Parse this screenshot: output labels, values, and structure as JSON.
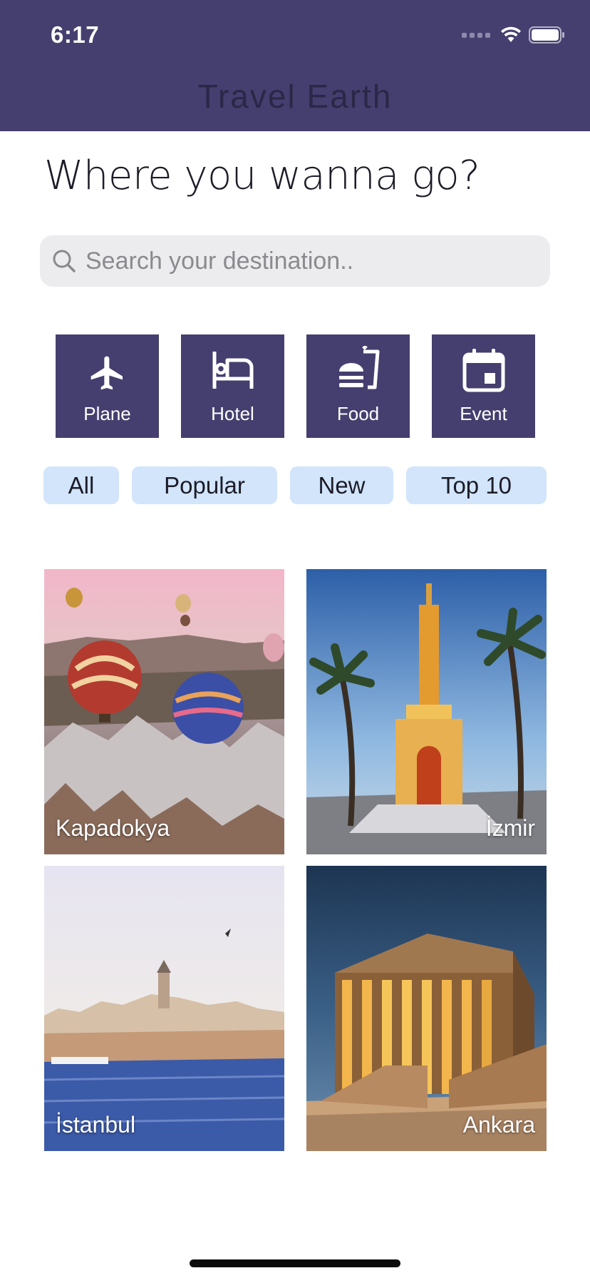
{
  "status_bar": {
    "time": "6:17"
  },
  "header": {
    "title": "Travel Earth"
  },
  "headline": "Where you wanna go?",
  "search": {
    "placeholder": "Search your destination.."
  },
  "categories": [
    {
      "label": "Plane",
      "icon": "plane-icon"
    },
    {
      "label": "Hotel",
      "icon": "bed-icon"
    },
    {
      "label": "Food",
      "icon": "food-icon"
    },
    {
      "label": "Event",
      "icon": "calendar-icon"
    }
  ],
  "filters": [
    "All",
    "Popular",
    "New",
    "Top 10"
  ],
  "destinations": [
    {
      "name": "Kapadokya"
    },
    {
      "name": "İzmir"
    },
    {
      "name": "İstanbul"
    },
    {
      "name": "Ankara"
    }
  ],
  "colors": {
    "primary": "#453f6f",
    "chip": "#d2e5fb",
    "search_bg": "#ececee"
  }
}
